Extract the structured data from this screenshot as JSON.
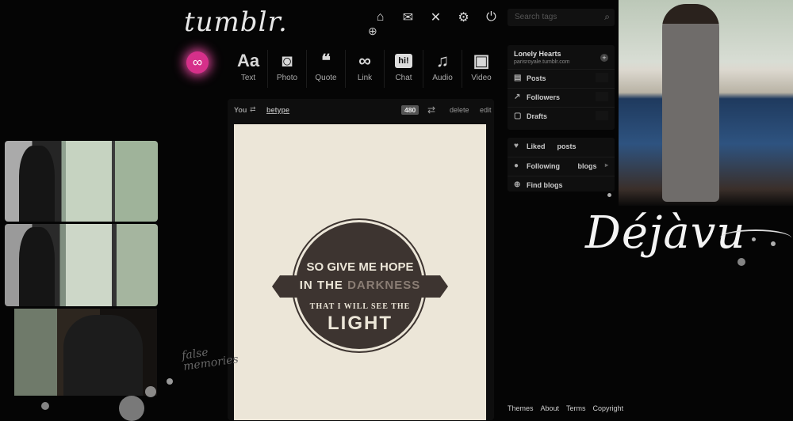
{
  "header": {
    "logo": "tumblr.",
    "nav_icons": [
      "home-icon",
      "mail-icon",
      "activity-icon",
      "gear-icon",
      "power-icon"
    ],
    "search": {
      "placeholder": "Search tags"
    }
  },
  "post_types": [
    {
      "label": "Text",
      "glyph": "Aa"
    },
    {
      "label": "Photo",
      "glyph": "◙"
    },
    {
      "label": "Quote",
      "glyph": "❝"
    },
    {
      "label": "Link",
      "glyph": "∞"
    },
    {
      "label": "Chat",
      "glyph": "hi!"
    },
    {
      "label": "Audio",
      "glyph": "♫"
    },
    {
      "label": "Video",
      "glyph": "▣"
    }
  ],
  "post": {
    "author": "You",
    "reblog_from": "betype",
    "notes": "480",
    "delete": "delete",
    "edit": "edit",
    "quote_line1": "SO GIVE ME HOPE",
    "quote_line2a": "IN THE ",
    "quote_line2b": "DARKNESS",
    "quote_line3": "THAT I WILL SEE THE",
    "quote_line4": "LIGHT"
  },
  "sidebar": {
    "blog_name": "Lonely Hearts",
    "blog_url": "parisroyale.tumblr.com",
    "blog_items": [
      {
        "label": "Posts",
        "icon": "document-icon"
      },
      {
        "label": "Followers",
        "icon": "chart-icon"
      },
      {
        "label": "Drafts",
        "icon": "draft-icon"
      }
    ],
    "account_items": [
      {
        "label": "Liked      posts",
        "icon": "heart-icon"
      },
      {
        "label": "Following         blogs",
        "icon": "person-icon"
      },
      {
        "label": "Find blogs",
        "icon": "find-icon"
      }
    ]
  },
  "footer": [
    "Themes",
    "About",
    "Terms",
    "Copyright"
  ],
  "theme": {
    "title": "Déjàvu",
    "caption_line1": "false",
    "caption_line2": "memories",
    "accent_pink": "#e0469c"
  }
}
